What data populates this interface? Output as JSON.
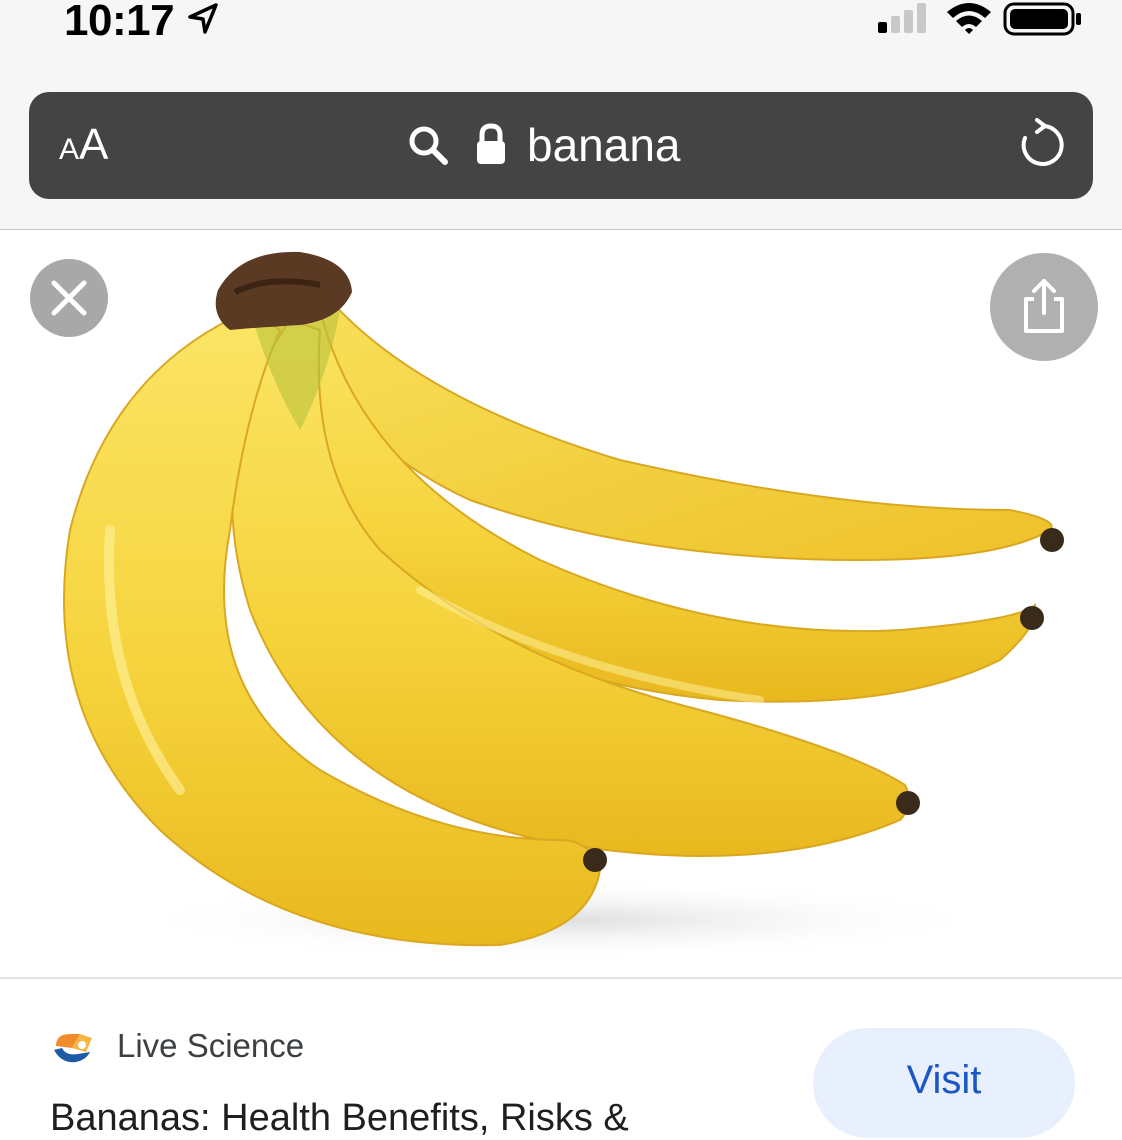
{
  "status_bar": {
    "time": "10:17",
    "icons": [
      "location-arrow-icon",
      "cellular-signal-icon",
      "wifi-icon",
      "battery-icon"
    ]
  },
  "toolbar": {
    "text_size_label_small": "A",
    "text_size_label_large": "A",
    "url": "banana",
    "icons": [
      "search-icon",
      "lock-icon",
      "reload-icon"
    ]
  },
  "viewer": {
    "image_subject": "bunch of bananas",
    "icons": [
      "close-icon",
      "share-icon"
    ]
  },
  "result": {
    "source": "Live Science",
    "title": "Bananas: Health Benefits, Risks &",
    "visit_label": "Visit"
  },
  "colors": {
    "address_bar_bg": "#444444",
    "visit_button_bg": "#e8f0fe",
    "visit_text": "#1a56c4",
    "banana_yellow": "#f5d23a"
  }
}
